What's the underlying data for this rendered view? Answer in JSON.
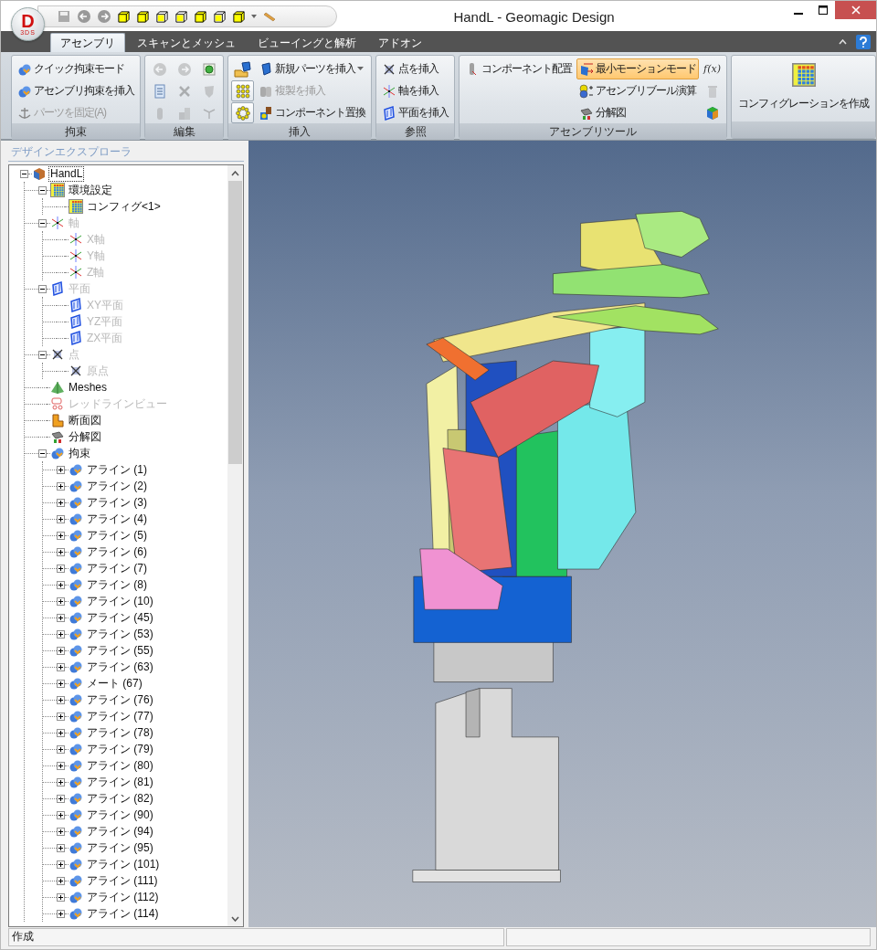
{
  "window": {
    "title": "HandL - Geomagic Design",
    "logo": "D",
    "logo_sub": "3DS"
  },
  "tabs": [
    {
      "label": "アセンブリ",
      "selected": true
    },
    {
      "label": "スキャンとメッシュ",
      "selected": false
    },
    {
      "label": "ビューイングと解析",
      "selected": false
    },
    {
      "label": "アドオン",
      "selected": false
    }
  ],
  "ribbon": {
    "groups": [
      {
        "title": "拘束",
        "columns": [
          [
            {
              "kind": "button",
              "label": "クイック拘束モード",
              "disabled": false
            },
            {
              "kind": "button",
              "label": "アセンブリ拘束を挿入",
              "disabled": false
            },
            {
              "kind": "button",
              "label": "パーツを固定(A)",
              "disabled": true
            }
          ]
        ]
      },
      {
        "title": "編集",
        "columns": [
          [
            {
              "kind": "tool",
              "disabled": true
            },
            {
              "kind": "tool",
              "disabled": false
            },
            {
              "kind": "tool",
              "disabled": true
            }
          ],
          [
            {
              "kind": "tool",
              "disabled": true
            },
            {
              "kind": "tool",
              "disabled": true
            },
            {
              "kind": "tool",
              "disabled": true
            }
          ],
          [
            {
              "kind": "tool",
              "disabled": false
            },
            {
              "kind": "tool",
              "disabled": true
            },
            {
              "kind": "tool",
              "disabled": true
            }
          ]
        ]
      },
      {
        "title": "挿入",
        "columns": [
          [
            {
              "kind": "tool",
              "disabled": false
            },
            {
              "kind": "framed",
              "disabled": false
            },
            {
              "kind": "framed",
              "disabled": false
            }
          ],
          [
            {
              "kind": "menu",
              "label": "新規パーツを挿入",
              "disabled": false
            },
            {
              "kind": "button",
              "label": "複製を挿入",
              "disabled": true
            },
            {
              "kind": "button",
              "label": "コンポーネント置換",
              "disabled": false
            }
          ]
        ]
      },
      {
        "title": "参照",
        "columns": [
          [
            {
              "kind": "button",
              "label": "点を挿入",
              "disabled": false
            },
            {
              "kind": "button",
              "label": "軸を挿入",
              "disabled": false
            },
            {
              "kind": "button",
              "label": "平面を挿入",
              "disabled": false
            }
          ]
        ]
      },
      {
        "title": "アセンブリツール",
        "columns": [
          [
            {
              "kind": "button",
              "label": "コンポーネント配置",
              "disabled": false
            }
          ],
          [
            {
              "kind": "toggle",
              "label": "最小モーションモード",
              "selected": true,
              "disabled": false
            },
            {
              "kind": "button",
              "label": "アセンブリブール演算",
              "disabled": false
            },
            {
              "kind": "button",
              "label": "分解図",
              "disabled": false
            }
          ],
          [
            {
              "kind": "glyph",
              "label": "f(x)",
              "disabled": false
            },
            {
              "kind": "tool",
              "disabled": true
            },
            {
              "kind": "tool",
              "disabled": false
            }
          ]
        ]
      },
      {
        "columns": [
          [
            {
              "kind": "large",
              "label": "コンフィグレーションを作成",
              "disabled": false
            }
          ]
        ]
      }
    ]
  },
  "explorer": {
    "title": "デザインエクスプローラ",
    "items": [
      {
        "kind": "assembly",
        "label": "HandL",
        "selected": true,
        "expanded": true,
        "disabled": false,
        "children": [
          {
            "kind": "config",
            "label": "環境設定",
            "selected": false,
            "expanded": true,
            "disabled": false,
            "children": [
              {
                "kind": "config",
                "label": "コンフィグ<1>",
                "selected": false,
                "disabled": false
              }
            ]
          },
          {
            "kind": "axis",
            "label": "軸",
            "selected": false,
            "expanded": true,
            "disabled": true,
            "children": [
              {
                "kind": "axis",
                "label": "X軸",
                "selected": false,
                "disabled": true
              },
              {
                "kind": "axis",
                "label": "Y軸",
                "selected": false,
                "disabled": true
              },
              {
                "kind": "axis",
                "label": "Z軸",
                "selected": false,
                "disabled": true
              }
            ]
          },
          {
            "kind": "plane",
            "label": "平面",
            "selected": false,
            "expanded": true,
            "disabled": true,
            "children": [
              {
                "kind": "plane",
                "label": "XY平面",
                "selected": false,
                "disabled": true
              },
              {
                "kind": "plane",
                "label": "YZ平面",
                "selected": false,
                "disabled": true
              },
              {
                "kind": "plane",
                "label": "ZX平面",
                "selected": false,
                "disabled": true
              }
            ]
          },
          {
            "kind": "point",
            "label": "点",
            "selected": false,
            "expanded": true,
            "disabled": true,
            "children": [
              {
                "kind": "point",
                "label": "原点",
                "selected": false,
                "disabled": true
              }
            ]
          },
          {
            "kind": "mesh",
            "label": "Meshes",
            "selected": false,
            "disabled": false
          },
          {
            "kind": "redline",
            "label": "レッドラインビュー",
            "selected": false,
            "disabled": true
          },
          {
            "kind": "section",
            "label": "断面図",
            "selected": false,
            "disabled": false
          },
          {
            "kind": "exploded",
            "label": "分解図",
            "selected": false,
            "disabled": false
          },
          {
            "kind": "constraint",
            "label": "拘束",
            "selected": false,
            "expanded": true,
            "disabled": false,
            "children": [
              {
                "kind": "constraint",
                "label": "アライン (1)",
                "selected": false,
                "expanded": false,
                "disabled": false
              },
              {
                "kind": "constraint",
                "label": "アライン (2)",
                "selected": false,
                "expanded": false,
                "disabled": false
              },
              {
                "kind": "constraint",
                "label": "アライン (3)",
                "selected": false,
                "expanded": false,
                "disabled": false
              },
              {
                "kind": "constraint",
                "label": "アライン (4)",
                "selected": false,
                "expanded": false,
                "disabled": false
              },
              {
                "kind": "constraint",
                "label": "アライン (5)",
                "selected": false,
                "expanded": false,
                "disabled": false
              },
              {
                "kind": "constraint",
                "label": "アライン (6)",
                "selected": false,
                "expanded": false,
                "disabled": false
              },
              {
                "kind": "constraint",
                "label": "アライン (7)",
                "selected": false,
                "expanded": false,
                "disabled": false
              },
              {
                "kind": "constraint",
                "label": "アライン (8)",
                "selected": false,
                "expanded": false,
                "disabled": false
              },
              {
                "kind": "constraint",
                "label": "アライン (10)",
                "selected": false,
                "expanded": false,
                "disabled": false
              },
              {
                "kind": "constraint",
                "label": "アライン (45)",
                "selected": false,
                "expanded": false,
                "disabled": false
              },
              {
                "kind": "constraint",
                "label": "アライン (53)",
                "selected": false,
                "expanded": false,
                "disabled": false
              },
              {
                "kind": "constraint",
                "label": "アライン (55)",
                "selected": false,
                "expanded": false,
                "disabled": false
              },
              {
                "kind": "constraint",
                "label": "アライン (63)",
                "selected": false,
                "expanded": false,
                "disabled": false
              },
              {
                "kind": "constraint",
                "label": "メート (67)",
                "selected": false,
                "expanded": false,
                "disabled": false
              },
              {
                "kind": "constraint",
                "label": "アライン (76)",
                "selected": false,
                "expanded": false,
                "disabled": false
              },
              {
                "kind": "constraint",
                "label": "アライン (77)",
                "selected": false,
                "expanded": false,
                "disabled": false
              },
              {
                "kind": "constraint",
                "label": "アライン (78)",
                "selected": false,
                "expanded": false,
                "disabled": false
              },
              {
                "kind": "constraint",
                "label": "アライン (79)",
                "selected": false,
                "expanded": false,
                "disabled": false
              },
              {
                "kind": "constraint",
                "label": "アライン (80)",
                "selected": false,
                "expanded": false,
                "disabled": false
              },
              {
                "kind": "constraint",
                "label": "アライン (81)",
                "selected": false,
                "expanded": false,
                "disabled": false
              },
              {
                "kind": "constraint",
                "label": "アライン (82)",
                "selected": false,
                "expanded": false,
                "disabled": false
              },
              {
                "kind": "constraint",
                "label": "アライン (90)",
                "selected": false,
                "expanded": false,
                "disabled": false
              },
              {
                "kind": "constraint",
                "label": "アライン (94)",
                "selected": false,
                "expanded": false,
                "disabled": false
              },
              {
                "kind": "constraint",
                "label": "アライン (95)",
                "selected": false,
                "expanded": false,
                "disabled": false
              },
              {
                "kind": "constraint",
                "label": "アライン (101)",
                "selected": false,
                "expanded": false,
                "disabled": false
              },
              {
                "kind": "constraint",
                "label": "アライン (111)",
                "selected": false,
                "expanded": false,
                "disabled": false
              },
              {
                "kind": "constraint",
                "label": "アライン (112)",
                "selected": false,
                "expanded": false,
                "disabled": false
              },
              {
                "kind": "constraint",
                "label": "アライン (114)",
                "selected": false,
                "expanded": false,
                "disabled": false
              }
            ]
          }
        ]
      }
    ]
  },
  "status_bar": {
    "message": "作成"
  }
}
